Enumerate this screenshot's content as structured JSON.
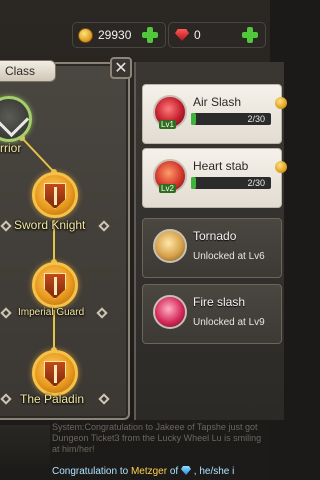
{
  "currency": {
    "gold": "29930",
    "gems": "0"
  },
  "panel": {
    "tab_label": "Class",
    "close_label": "✕"
  },
  "class_tree": [
    {
      "name": "rrior"
    },
    {
      "name": "Sword Knight"
    },
    {
      "name": "Imperial Guard"
    },
    {
      "name": "The Paladin"
    }
  ],
  "skills": [
    {
      "name": "Air Slash",
      "level": "Lv1",
      "progress_text": "2/30",
      "progress": 0.0667
    },
    {
      "name": "Heart stab",
      "level": "Lv2",
      "progress_text": "2/30",
      "progress": 0.0667
    },
    {
      "name": "Tornado",
      "status": "Unlocked at Lv6"
    },
    {
      "name": "Fire slash",
      "status": "Unlocked at Lv9"
    }
  ],
  "chat": {
    "faint_text": "System:Congratulation to Jakeee of Tapshe just got Dungeon Ticket3 from the Lucky Wheel Lu is smiling at him/her!",
    "prefix": "Congratulation to",
    "player": "Metzger",
    "middle": "of",
    "suffix": ", he/she i"
  }
}
